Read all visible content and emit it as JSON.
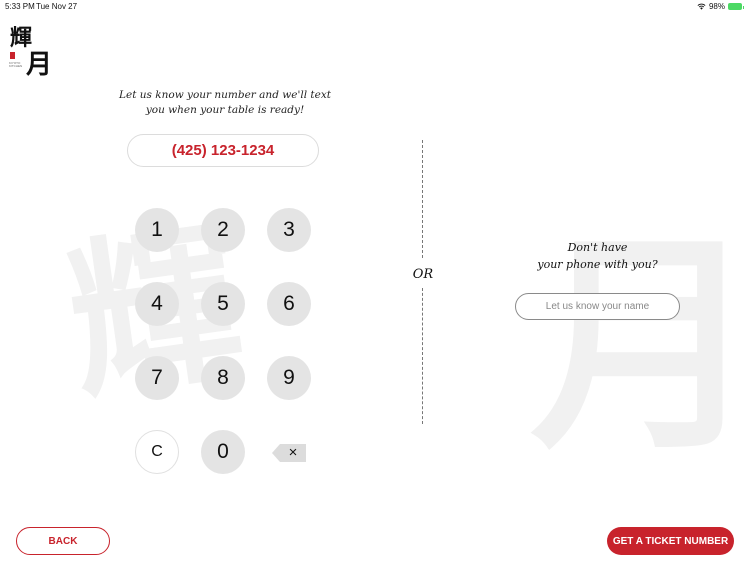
{
  "status_bar": {
    "time": "5:33 PM",
    "date": "Tue Nov 27",
    "battery": "98%",
    "icons": [
      "wifi-icon",
      "battery-icon"
    ]
  },
  "logo": {
    "chars": [
      "輝",
      "月"
    ],
    "seal_color": "#c8232c",
    "subtitle": "KIYOTO KITCHEN"
  },
  "watermark": {
    "left_char": "輝",
    "right_char": "月"
  },
  "phone_section": {
    "prompt": "Let us know your number and we'll text you when your table is ready!",
    "phone_value": "(425) 123-1234",
    "keypad": {
      "keys": [
        "1",
        "2",
        "3",
        "4",
        "5",
        "6",
        "7",
        "8",
        "9",
        "C",
        "0"
      ],
      "backspace_icon": "backspace-icon",
      "backspace_glyph": "×"
    }
  },
  "divider": {
    "or_label": "OR"
  },
  "name_section": {
    "prompt_line1": "Don't have",
    "prompt_line2": "your phone with you?",
    "name_placeholder": "Let us know your name",
    "name_value": ""
  },
  "footer": {
    "back_label": "BACK",
    "ticket_label": "GET A TICKET NUMBER"
  },
  "colors": {
    "accent": "#c8232c",
    "key_bg": "#e4e4e4",
    "watermark": "#f1f1f1"
  }
}
